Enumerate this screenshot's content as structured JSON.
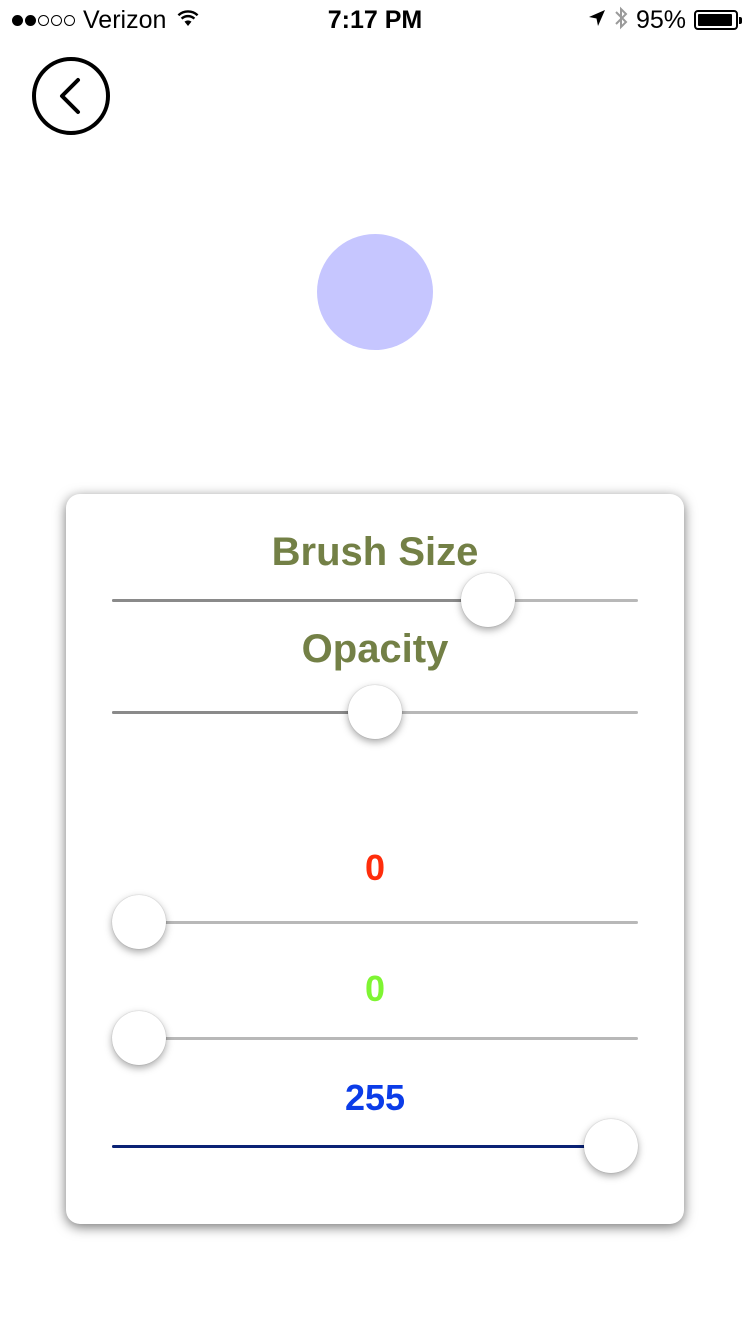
{
  "status_bar": {
    "signal_filled": 2,
    "signal_total": 5,
    "carrier": "Verizon",
    "time": "7:17 PM",
    "battery_percent": "95%",
    "battery_level": 0.95
  },
  "preview": {
    "color": "#c6c6ff"
  },
  "panel": {
    "brush_size": {
      "label": "Brush Size",
      "value": 0.74,
      "color": "#738046"
    },
    "opacity": {
      "label": "Opacity",
      "value": 0.5
    },
    "red": {
      "label": "0",
      "value": 0,
      "color": "#ff2d0c"
    },
    "green": {
      "label": "0",
      "value": 0,
      "color": "#7ef532"
    },
    "blue": {
      "label": "255",
      "value": 1.0,
      "color": "#0b3ce8",
      "track_color": "#0a2275"
    }
  },
  "colors": {
    "accent_label": "#738046",
    "track": "#b8b8b8"
  }
}
